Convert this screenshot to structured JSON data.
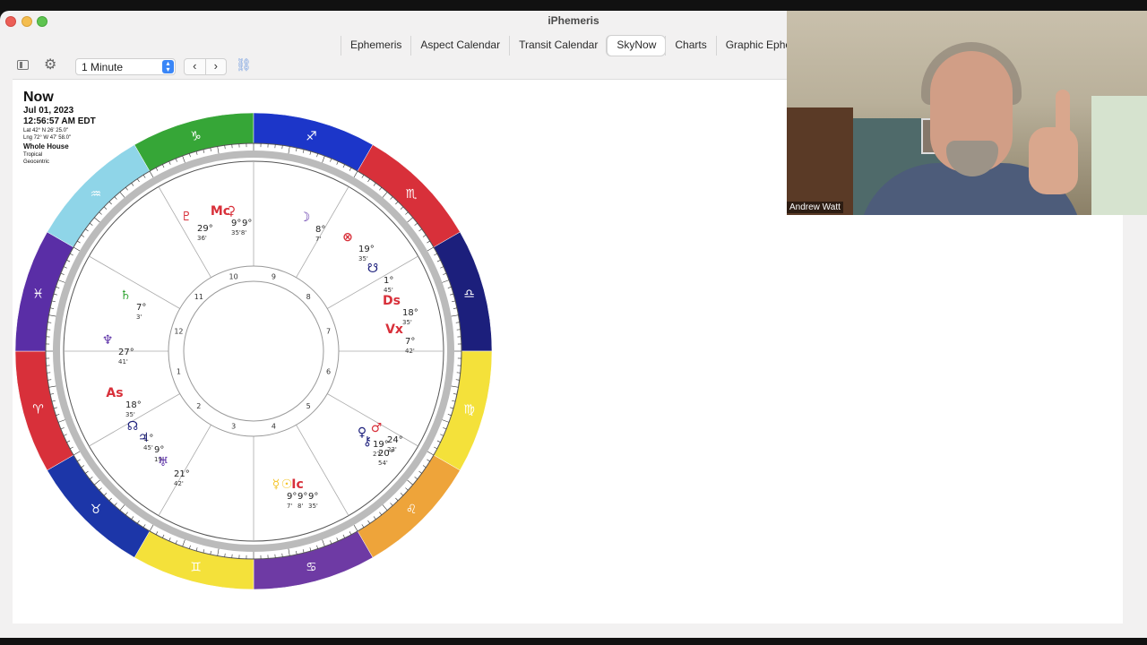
{
  "window": {
    "title": "iPhemeris"
  },
  "tabs": [
    {
      "label": "Ephemeris"
    },
    {
      "label": "Aspect Calendar"
    },
    {
      "label": "Transit Calendar"
    },
    {
      "label": "SkyNow",
      "active": true
    },
    {
      "label": "Charts"
    },
    {
      "label": "Graphic Epheme"
    }
  ],
  "toolbar": {
    "sidebar_icon": "sidebar-icon",
    "settings_icon": "gear-icon",
    "interval_value": "1 Minute",
    "prev_icon": "chevron-left-icon",
    "next_icon": "chevron-right-icon",
    "link_icon": "link-icon"
  },
  "chart_header": {
    "title": "Now",
    "date": "Jul 01, 2023",
    "time": "12:56:57 AM EDT",
    "lat": "Lat 42° N 26' 25.0\"",
    "lng": "Lng 72° W 47' 58.0\"",
    "house_system": "Whole House",
    "zodiac": "Tropical",
    "perspective": "Geocentric"
  },
  "zodiac_signs": [
    {
      "glyph": "♑",
      "color": "#36a637"
    },
    {
      "glyph": "♐",
      "color": "#1c36c9"
    },
    {
      "glyph": "♏",
      "color": "#d8303a"
    },
    {
      "glyph": "♎",
      "color": "#1c1f7c"
    },
    {
      "glyph": "♍",
      "color": "#f4e13a"
    },
    {
      "glyph": "♌",
      "color": "#eea43a"
    },
    {
      "glyph": "♋",
      "color": "#6e3aa4"
    },
    {
      "glyph": "♊",
      "color": "#f4e13a"
    },
    {
      "glyph": "♉",
      "color": "#1c36a8"
    },
    {
      "glyph": "♈",
      "color": "#d8303a"
    },
    {
      "glyph": "♓",
      "color": "#5a2ea6"
    },
    {
      "glyph": "♒",
      "color": "#8fd5e8"
    }
  ],
  "houses": [
    "1",
    "2",
    "3",
    "4",
    "5",
    "6",
    "7",
    "8",
    "9",
    "10",
    "11",
    "12"
  ],
  "planets": [
    {
      "glyph": "♇",
      "deg": "29°",
      "min": "36'",
      "color": "#d8303a"
    },
    {
      "glyph": "Mc",
      "deg": "9°",
      "sub": "♑♑",
      "min": "35'8'",
      "color": "#d8303a"
    },
    {
      "glyph": "⚳",
      "deg": "9°",
      "color": "#d8303a"
    },
    {
      "glyph": "☽",
      "deg": "8°",
      "min": "7'",
      "color": "#5a2ea6"
    },
    {
      "glyph": "⊗",
      "deg": "19°",
      "min": "35'",
      "color": "#d8303a"
    },
    {
      "glyph": "☋",
      "deg": "1°",
      "min": "45'",
      "color": "#1c1f7c"
    },
    {
      "glyph": "Ds",
      "deg": "18°",
      "min": "35'",
      "color": "#d8303a"
    },
    {
      "glyph": "Vx",
      "deg": "7°",
      "min": "42'",
      "color": "#d8303a"
    },
    {
      "glyph": "♄",
      "deg": "7°",
      "min": "3'",
      "color": "#36a637"
    },
    {
      "glyph": "♆",
      "deg": "27°",
      "min": "41'",
      "color": "#5a2ea6"
    },
    {
      "glyph": "As",
      "deg": "18°",
      "min": "35'",
      "color": "#d8303a"
    },
    {
      "glyph": "☊",
      "deg": "1°",
      "min": "45'",
      "color": "#1c1f7c"
    },
    {
      "glyph": "♃",
      "deg": "9°",
      "min": "19'",
      "color": "#1c1f7c"
    },
    {
      "glyph": "♅",
      "deg": "21°",
      "min": "42'",
      "color": "#5a2ea6"
    },
    {
      "glyph": "♂",
      "deg": "24°",
      "min": "23'",
      "color": "#d8303a"
    },
    {
      "glyph": "⚷",
      "deg": "20°",
      "min": "54'",
      "color": "#1c1f7c"
    },
    {
      "glyph": "♀",
      "deg": "19°",
      "min": "27'",
      "color": "#1c1f7c"
    },
    {
      "glyph": "☿",
      "deg": "9°",
      "min": "7'",
      "color": "#f4c52a"
    },
    {
      "glyph": "☉",
      "deg": "9°",
      "min": "8'",
      "color": "#f4c52a"
    },
    {
      "glyph": "Ic",
      "deg": "9°",
      "min": "35'",
      "color": "#d8303a"
    }
  ],
  "video": {
    "participant_name": "Andrew Watt"
  }
}
